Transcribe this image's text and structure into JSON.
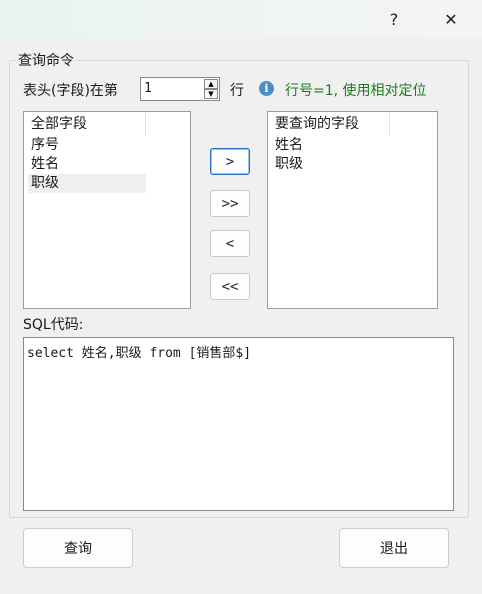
{
  "titlebar": {
    "help_label": "?",
    "close_label": "✕"
  },
  "group": {
    "title": "查询命令"
  },
  "header_row": {
    "prefix_label": "表头(字段)在第",
    "row_value": "1",
    "suffix_label": "行",
    "hint": "行号=1, 使用相对定位"
  },
  "left_list": {
    "header": "全部字段",
    "items": [
      "序号",
      "姓名",
      "职级"
    ],
    "selected_index": 2
  },
  "right_list": {
    "header": "要查询的字段",
    "items": [
      "姓名",
      "职级"
    ]
  },
  "move_buttons": {
    "add_one": ">",
    "add_all": ">>",
    "remove_one": "<",
    "remove_all": "<<"
  },
  "sql": {
    "label": "SQL代码:",
    "code": "select 姓名,职级 from [销售部$]"
  },
  "buttons": {
    "query": "查询",
    "exit": "退出"
  }
}
